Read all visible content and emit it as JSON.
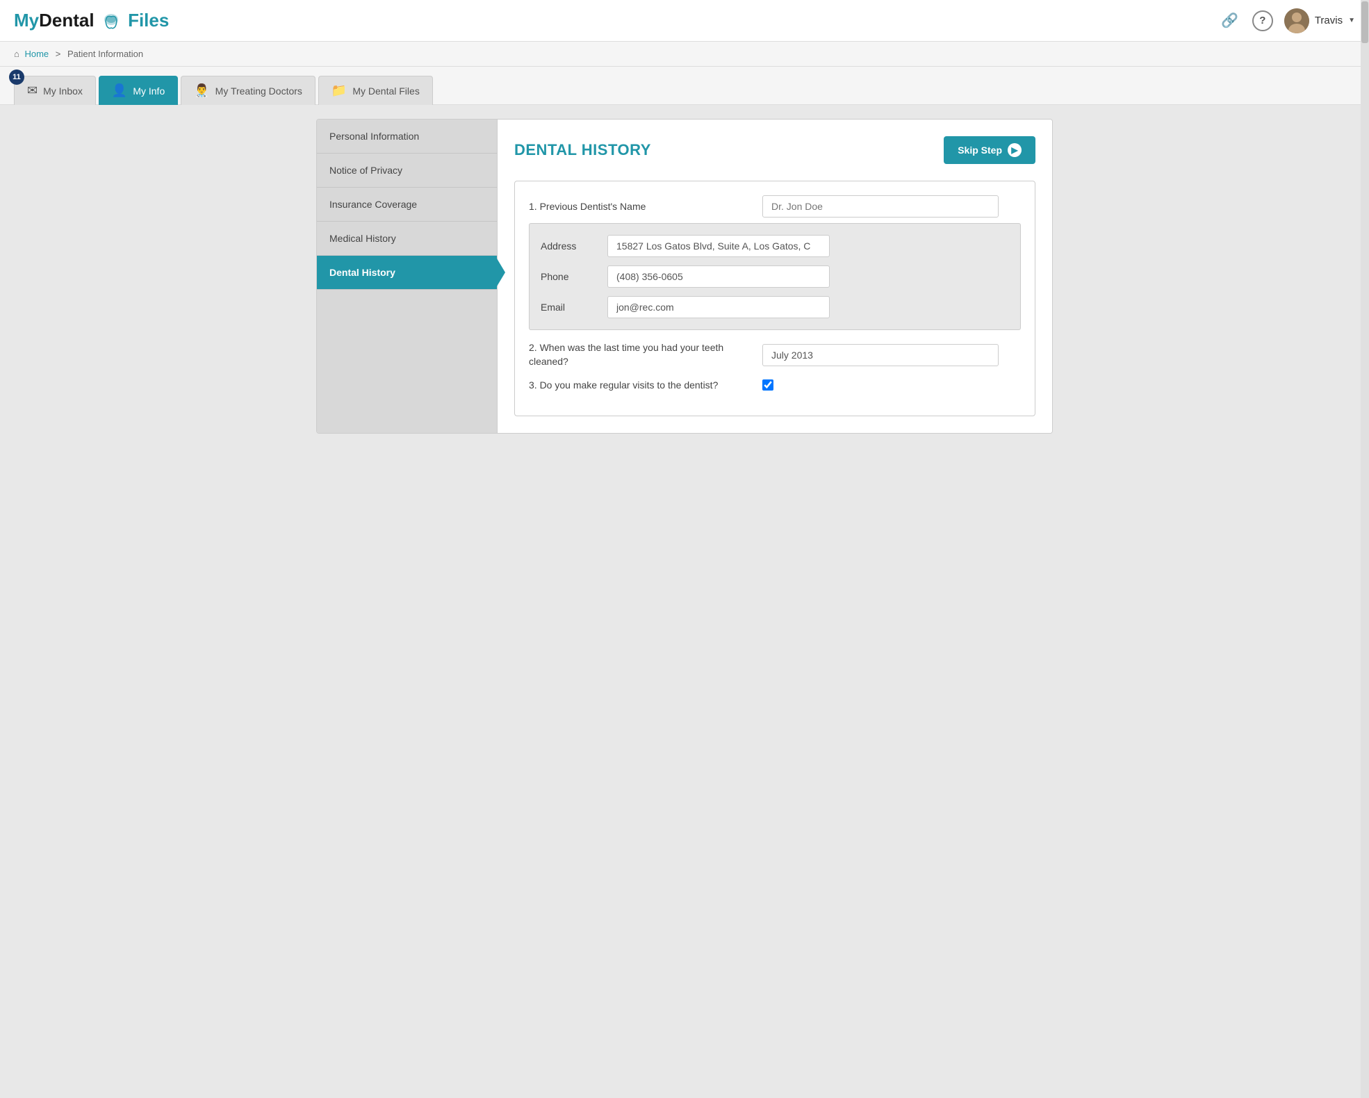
{
  "header": {
    "logo": {
      "my": "My",
      "dental": "Dental",
      "files": "Files"
    },
    "icons": {
      "link": "🔗",
      "help": "?",
      "help_aria": "help-icon"
    },
    "user": {
      "name": "Travis",
      "dropdown_arrow": "▼"
    }
  },
  "breadcrumb": {
    "home_label": "Home",
    "separator": ">",
    "current": "Patient Information"
  },
  "tabs": [
    {
      "id": "inbox",
      "label": "My Inbox",
      "active": false
    },
    {
      "id": "info",
      "label": "My Info",
      "active": true
    },
    {
      "id": "doctors",
      "label": "My Treating Doctors",
      "active": false
    },
    {
      "id": "files",
      "label": "My Dental Files",
      "active": false
    }
  ],
  "inbox_badge": "11",
  "sidebar": {
    "items": [
      {
        "id": "personal",
        "label": "Personal Information",
        "active": false
      },
      {
        "id": "privacy",
        "label": "Notice of Privacy",
        "active": false
      },
      {
        "id": "insurance",
        "label": "Insurance Coverage",
        "active": false
      },
      {
        "id": "medical",
        "label": "Medical History",
        "active": false
      },
      {
        "id": "dental",
        "label": "Dental History",
        "active": true
      }
    ]
  },
  "main": {
    "title": "DENTAL HISTORY",
    "skip_button": "Skip Step",
    "questions": {
      "q1_label": "1. Previous Dentist's Name",
      "q1_placeholder": "Dr. Jon Doe",
      "address_label": "Address",
      "address_value": "15827 Los Gatos Blvd, Suite A, Los Gatos, C",
      "phone_label": "Phone",
      "phone_value": "(408) 356-0605",
      "email_label": "Email",
      "email_value": "jon@rec.com",
      "q2_label": "2. When was the last time you had your teeth cleaned?",
      "q2_value": "July 2013",
      "q3_label": "3. Do you make regular visits to the dentist?",
      "q3_checked": true
    }
  }
}
